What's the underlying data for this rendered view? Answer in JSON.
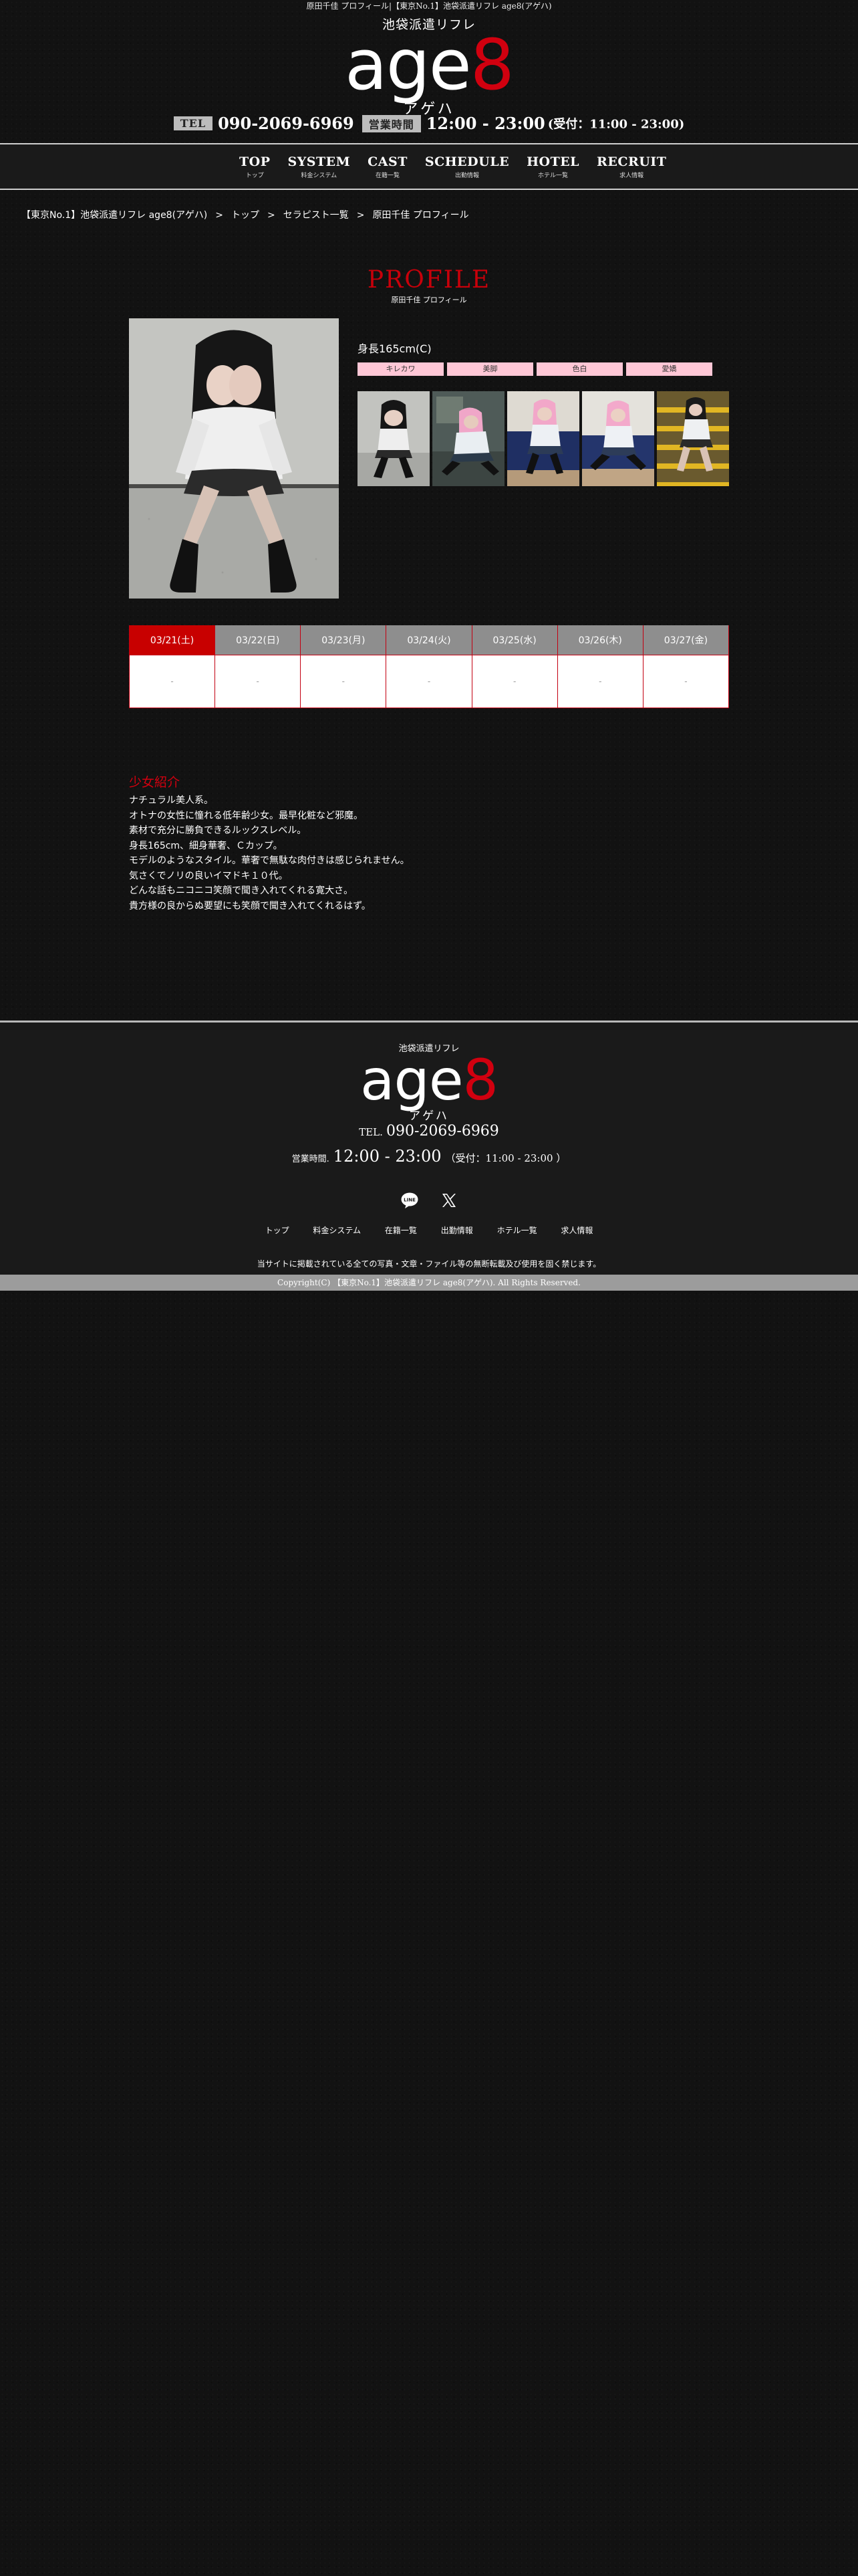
{
  "header": {
    "tagline": "原田千佳 プロフィール|【東京No.1】池袋派遣リフレ age8(アゲハ)",
    "logo_sub": "池袋派遣リフレ",
    "logo_main_white": "age",
    "logo_main_red": "8",
    "logo_kana": "アゲハ",
    "tel_label": "TEL",
    "tel": "090-2069-6969",
    "hours_label": "営業時間",
    "hours": "12:00 - 23:00",
    "reception": "(受付：11:00 - 23:00)"
  },
  "nav": [
    {
      "en": "TOP",
      "ja": "トップ"
    },
    {
      "en": "SYSTEM",
      "ja": "料金システム"
    },
    {
      "en": "CAST",
      "ja": "在籍一覧"
    },
    {
      "en": "SCHEDULE",
      "ja": "出勤情報"
    },
    {
      "en": "HOTEL",
      "ja": "ホテル一覧"
    },
    {
      "en": "RECRUIT",
      "ja": "求人情報"
    }
  ],
  "breadcrumb": [
    "【東京No.1】池袋派遣リフレ age8(アゲハ)",
    "トップ",
    "セラピスト一覧",
    "原田千佳 プロフィール"
  ],
  "breadcrumb_sep": ">",
  "profile": {
    "title": "PROFILE",
    "subtitle": "原田千佳 プロフィール",
    "height": "身長165cm(C)",
    "tags": [
      "キレカワ",
      "美脚",
      "色白",
      "愛嬌"
    ]
  },
  "schedule": {
    "days": [
      "03/21(土)",
      "03/22(日)",
      "03/23(月)",
      "03/24(火)",
      "03/25(水)",
      "03/26(木)",
      "03/27(金)"
    ],
    "values": [
      "-",
      "-",
      "-",
      "-",
      "-",
      "-",
      "-"
    ]
  },
  "intro": {
    "heading": "少女紹介",
    "lines": [
      "ナチュラル美人系。",
      "オトナの女性に憧れる低年齢少女。最早化粧など邪魔。",
      "素材で充分に勝負できるルックスレベル。",
      "身長165cm、細身華奢、Ｃカップ。",
      "モデルのようなスタイル。華奢で無駄な肉付きは感じられません。",
      "気さくでノリの良いイマドキ１０代。",
      "どんな話もニコニコ笑顔で聞き入れてくれる寛大さ。",
      "貴方様の良からぬ要望にも笑顔で聞き入れてくれるはず。"
    ]
  },
  "footer": {
    "logo_sub": "池袋派遣リフレ",
    "logo_main_white": "age",
    "logo_main_red": "8",
    "logo_kana": "アゲハ",
    "tel_label": "TEL.",
    "tel": "090-2069-6969",
    "hours_label": "営業時間.",
    "hours": "12:00 - 23:00",
    "reception": "（受付：11:00 - 23:00 ）",
    "social_icons": [
      "line-icon",
      "x-icon"
    ],
    "links": [
      "トップ",
      "料金システム",
      "在籍一覧",
      "出勤情報",
      "ホテル一覧",
      "求人情報"
    ],
    "notice": "当サイトに掲載されている全ての写真・文章・ファイル等の無断転載及び使用を固く禁じます。",
    "copyright": "Copyright(C) 【東京No.1】池袋派遣リフレ age8(アゲハ). All Rights Reserved."
  },
  "colors": {
    "accent_red": "#d1000f",
    "tag_pink": "#ffc7d6",
    "schedule_header": "#8e8e8e"
  }
}
